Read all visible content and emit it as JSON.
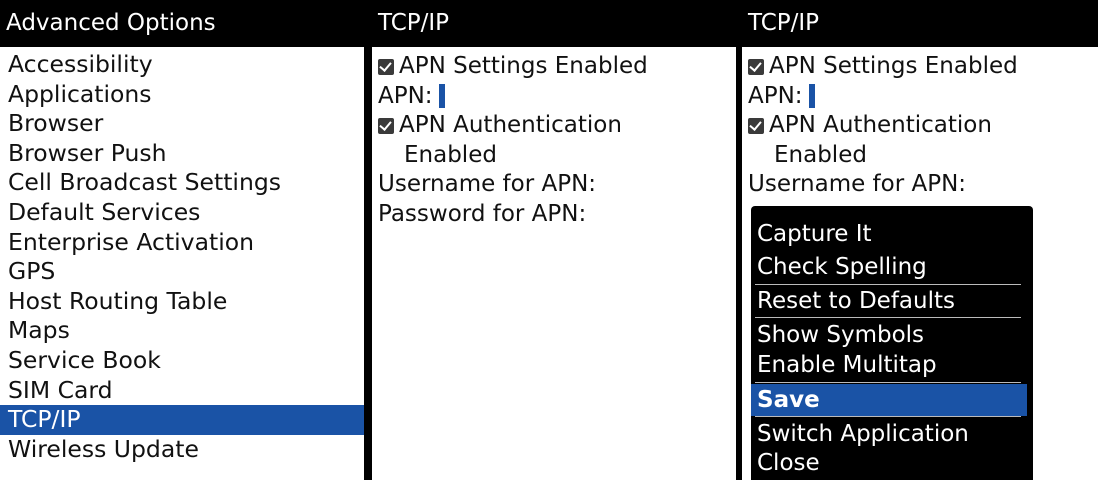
{
  "panel1": {
    "title": "Advanced Options",
    "items": [
      "Accessibility",
      "Applications",
      "Browser",
      "Browser Push",
      "Cell Broadcast Settings",
      "Default Services",
      "Enterprise Activation",
      "GPS",
      "Host Routing Table",
      "Maps",
      "Service Book",
      "SIM Card",
      "TCP/IP",
      "Wireless Update"
    ],
    "selected": "TCP/IP"
  },
  "panel2": {
    "title": "TCP/IP",
    "apn_settings_label": "APN Settings Enabled",
    "apn_label": "APN:",
    "apn_auth_label_1": "APN Authentication",
    "apn_auth_label_2": "Enabled",
    "username_label": "Username for APN:",
    "password_label": "Password for APN:"
  },
  "panel3": {
    "title": "TCP/IP",
    "apn_settings_label": "APN Settings Enabled",
    "apn_label": "APN:",
    "apn_auth_label_1": "APN Authentication",
    "apn_auth_label_2": "Enabled",
    "username_label": "Username for APN:",
    "menu": {
      "items": [
        "Capture It",
        "Check Spelling",
        "Reset to Defaults",
        "Show Symbols",
        "Enable Multitap",
        "Save",
        "Switch Application",
        "Close"
      ],
      "selected": "Save"
    }
  },
  "colors": {
    "selection": "#1a53a6",
    "titlebar": "#000000"
  }
}
